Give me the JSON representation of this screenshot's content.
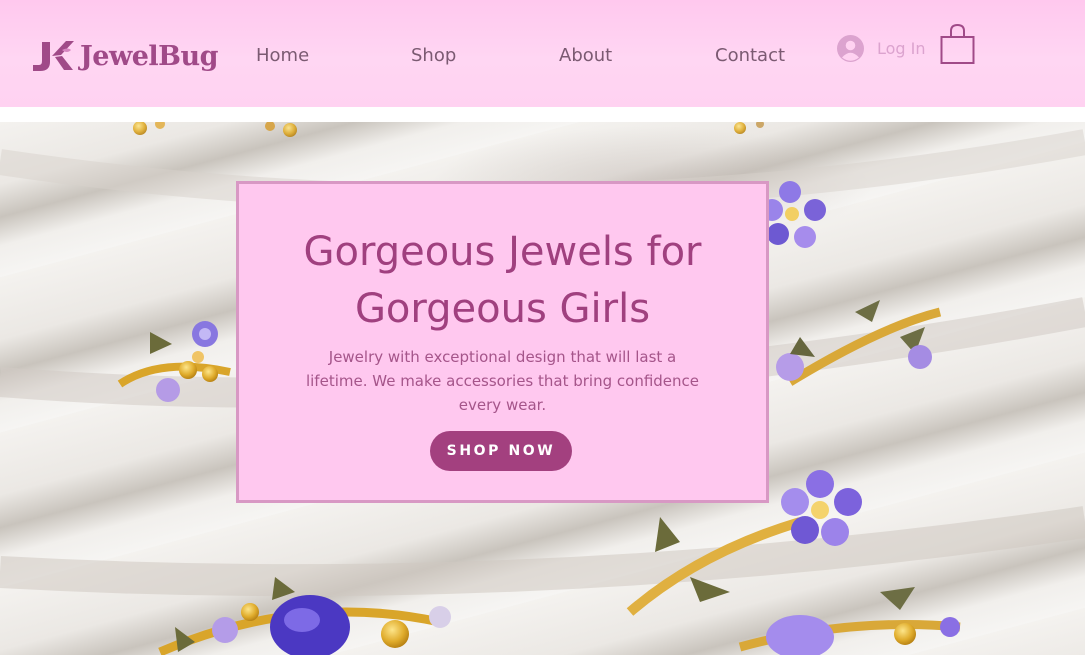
{
  "brand": {
    "name": "JewelBug",
    "logo_icon": "jk-monogram-logo"
  },
  "nav": {
    "items": [
      {
        "label": "Home"
      },
      {
        "label": "Shop"
      },
      {
        "label": "About"
      },
      {
        "label": "Contact"
      }
    ],
    "login_label": "Log In",
    "login_icon": "user-avatar-icon",
    "cart_icon": "shopping-bag-icon"
  },
  "hero": {
    "title_line1": "Gorgeous Jewels for",
    "title_line2": "Gorgeous Girls",
    "description": "Jewelry with exceptional design that will last a lifetime. We make accessories that bring confidence every wear.",
    "cta_label": "SHOP NOW"
  },
  "colors": {
    "header_bg": "#ffd2f1",
    "brand": "#a04a88",
    "nav_text": "#7b5a72",
    "login_text": "#dca3cf",
    "promo_bg": "#ffc8ef",
    "promo_border": "#d898c4",
    "cta_bg": "#a3407f"
  }
}
